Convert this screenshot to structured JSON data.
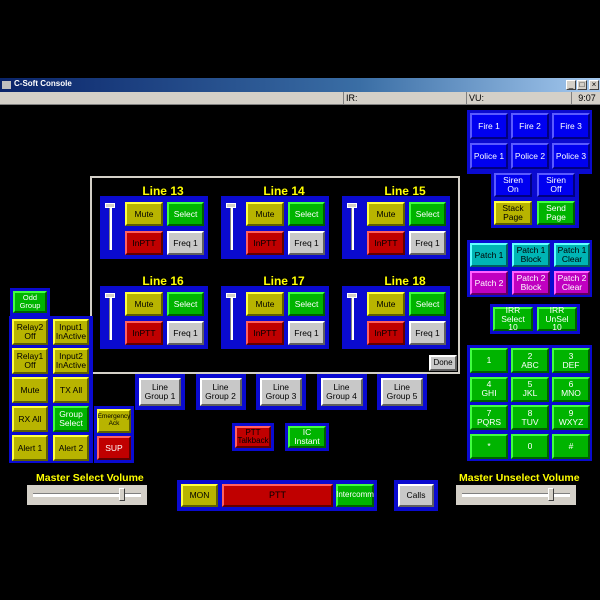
{
  "window": {
    "title": "C-Soft Console",
    "min_glyph": "_",
    "max_glyph": "□",
    "close_glyph": "×"
  },
  "status": {
    "ir_label": "IR:",
    "vu_label": "VU:",
    "time": "9:07"
  },
  "colors": {
    "blue": "#0000f0",
    "green": "#00b400",
    "olive": "#b8b400",
    "red": "#c00000",
    "gray": "#c8c8c8",
    "cyan": "#00b4b4",
    "magenta": "#c000c0",
    "title_yellow": "#ffff00"
  },
  "lines": [
    {
      "name": "Line 13",
      "mute": "Mute",
      "select": "Select",
      "inptt": "InPTT",
      "freq": "Freq 1",
      "volume_pct": 100
    },
    {
      "name": "Line 14",
      "mute": "Mute",
      "select": "Select",
      "inptt": "InPTT",
      "freq": "Freq 1",
      "volume_pct": 100
    },
    {
      "name": "Line 15",
      "mute": "Mute",
      "select": "Select",
      "inptt": "InPTT",
      "freq": "Freq 1",
      "volume_pct": 100
    },
    {
      "name": "Line 16",
      "mute": "Mute",
      "select": "Select",
      "inptt": "InPTT",
      "freq": "Freq 1",
      "volume_pct": 100
    },
    {
      "name": "Line 17",
      "mute": "Mute",
      "select": "Select",
      "inptt": "InPTT",
      "freq": "Freq 1",
      "volume_pct": 100
    },
    {
      "name": "Line 18",
      "mute": "Mute",
      "select": "Select",
      "inptt": "InPTT",
      "freq": "Freq 1",
      "volume_pct": 100
    }
  ],
  "panel": {
    "done": "Done"
  },
  "groups": [
    "Line\nGroup 1",
    "Line\nGroup 2",
    "Line\nGroup 3",
    "Line\nGroup 4",
    "Line\nGroup 5"
  ],
  "left": {
    "odd_group": "Odd\nGroup",
    "relay2": "Relay2\nOff",
    "input1": "Input1\nInActive",
    "relay1": "Relay1\nOff",
    "input2": "Input2\nInActive",
    "mute": "Mute",
    "tx_all": "TX All",
    "rx_all": "RX All",
    "group_select": "Group\nSelect",
    "emergency_ack": "Emergency\nAck",
    "alert1": "Alert 1",
    "alert2": "Alert 2",
    "sup": "SUP"
  },
  "center": {
    "ptt_talkback": "PTT\nTalkback",
    "ic_instant": "IC\nInstant"
  },
  "bottom": {
    "mon": "MON",
    "ptt": "PTT",
    "intercomm": "Intercomm",
    "calls": "Calls"
  },
  "volumes": {
    "master_select": {
      "label": "Master Select Volume",
      "value_pct": 84
    },
    "master_unselect": {
      "label": "Master Unselect Volume",
      "value_pct": 84
    }
  },
  "right": {
    "fire": [
      "Fire 1",
      "Fire 2",
      "Fire 3"
    ],
    "police": [
      "Police 1",
      "Police 2",
      "Police 3"
    ],
    "siren_on": "Siren On",
    "siren_off": "Siren Off",
    "stack_page": "Stack\nPage",
    "send_page": "Send\nPage",
    "patch1": "Patch 1",
    "patch1_block": "Patch 1\nBlock",
    "patch1_clear": "Patch 1\nClear",
    "patch2": "Patch 2",
    "patch2_block": "Patch 2\nBlock",
    "patch2_clear": "Patch 2\nClear",
    "irr_select": "IRR\nSelect 10",
    "irr_unsel": "IRR\nUnSel 10",
    "keypad": [
      "1",
      "2\nABC",
      "3\nDEF",
      "4\nGHI",
      "5\nJKL",
      "6\nMNO",
      "7\nPQRS",
      "8\nTUV",
      "9\nWXYZ",
      "*",
      "0",
      "#"
    ]
  }
}
